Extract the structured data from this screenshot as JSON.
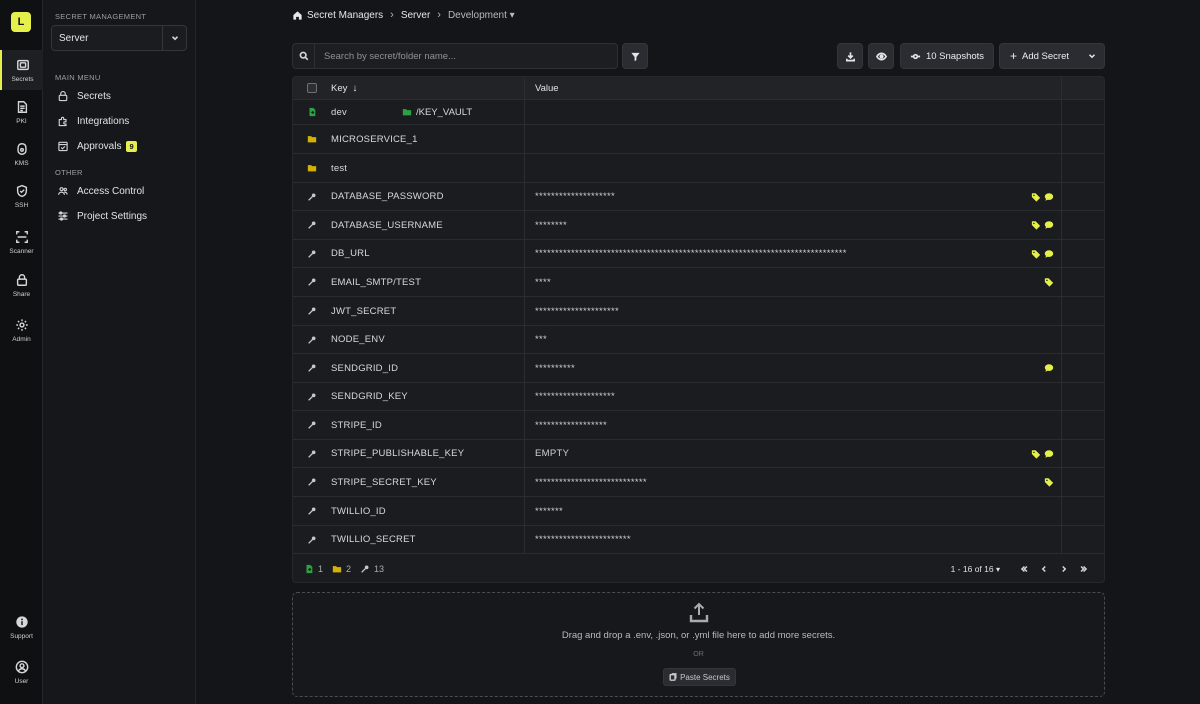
{
  "rail": {
    "logo_letter": "L",
    "items": [
      {
        "label": "Secrets",
        "icon": "vault-icon"
      },
      {
        "label": "PKI",
        "icon": "document-icon"
      },
      {
        "label": "KMS",
        "icon": "lock-icon"
      },
      {
        "label": "SSH",
        "icon": "shield-icon"
      },
      {
        "label": "Scanner",
        "icon": "scan-icon"
      },
      {
        "label": "Share",
        "icon": "share-lock-icon"
      },
      {
        "label": "Admin",
        "icon": "gear-icon"
      }
    ],
    "bottom": [
      {
        "label": "Support",
        "icon": "info-icon"
      },
      {
        "label": "User",
        "icon": "user-icon"
      }
    ]
  },
  "sidebar": {
    "heading": "SECRET MANAGEMENT",
    "project": "Server",
    "main_menu_heading": "MAIN MENU",
    "main_menu": [
      {
        "label": "Secrets",
        "icon": "lock-icon"
      },
      {
        "label": "Integrations",
        "icon": "puzzle-icon"
      },
      {
        "label": "Approvals",
        "icon": "check-calendar-icon",
        "badge": "9"
      }
    ],
    "other_heading": "OTHER",
    "other": [
      {
        "label": "Access Control",
        "icon": "users-icon"
      },
      {
        "label": "Project Settings",
        "icon": "sliders-icon"
      }
    ]
  },
  "breadcrumb": {
    "root": "Secret Managers",
    "project": "Server",
    "environment": "Development"
  },
  "toolbar": {
    "search_placeholder": "Search by secret/folder name...",
    "snapshots_label": "10 Snapshots",
    "add_secret_label": "Add Secret"
  },
  "table": {
    "headers": {
      "key": "Key",
      "value": "Value"
    },
    "rows": [
      {
        "type": "import",
        "key": "dev",
        "value": "/KEY_VAULT",
        "tags": []
      },
      {
        "type": "folder",
        "key": "MICROSERVICE_1",
        "value": "",
        "tags": []
      },
      {
        "type": "folder",
        "key": "test",
        "value": "",
        "tags": []
      },
      {
        "type": "secret",
        "key": "DATABASE_PASSWORD",
        "value": "********************",
        "tags": [
          "tag",
          "comment"
        ]
      },
      {
        "type": "secret",
        "key": "DATABASE_USERNAME",
        "value": "********",
        "tags": [
          "tag",
          "comment"
        ]
      },
      {
        "type": "secret",
        "key": "DB_URL",
        "value": "******************************************************************************",
        "tags": [
          "tag",
          "comment"
        ]
      },
      {
        "type": "secret",
        "key": "EMAIL_SMTP/TEST",
        "value": "****",
        "tags": [
          "tag"
        ]
      },
      {
        "type": "secret",
        "key": "JWT_SECRET",
        "value": "*********************",
        "tags": []
      },
      {
        "type": "secret",
        "key": "NODE_ENV",
        "value": "***",
        "tags": []
      },
      {
        "type": "secret",
        "key": "SENDGRID_ID",
        "value": "**********",
        "tags": [
          "comment"
        ]
      },
      {
        "type": "secret",
        "key": "SENDGRID_KEY",
        "value": "********************",
        "tags": []
      },
      {
        "type": "secret",
        "key": "STRIPE_ID",
        "value": "******************",
        "tags": []
      },
      {
        "type": "secret",
        "key": "STRIPE_PUBLISHABLE_KEY",
        "value": "EMPTY",
        "tags": [
          "tag",
          "comment"
        ]
      },
      {
        "type": "secret",
        "key": "STRIPE_SECRET_KEY",
        "value": "****************************",
        "tags": [
          "tag"
        ]
      },
      {
        "type": "secret",
        "key": "TWILLIO_ID",
        "value": "*******",
        "tags": []
      },
      {
        "type": "secret",
        "key": "TWILLIO_SECRET",
        "value": "************************",
        "tags": []
      }
    ],
    "footer": {
      "import_count": "1",
      "folder_count": "2",
      "secret_count": "13",
      "pagination": "1 - 16 of 16"
    }
  },
  "dropzone": {
    "message": "Drag and drop a .env, .json, or .yml file here to add more secrets.",
    "or": "OR",
    "paste_label": "Paste Secrets"
  },
  "colors": {
    "accent": "#e6f04a",
    "folder": "#d4b106",
    "import": "#2ea043"
  }
}
